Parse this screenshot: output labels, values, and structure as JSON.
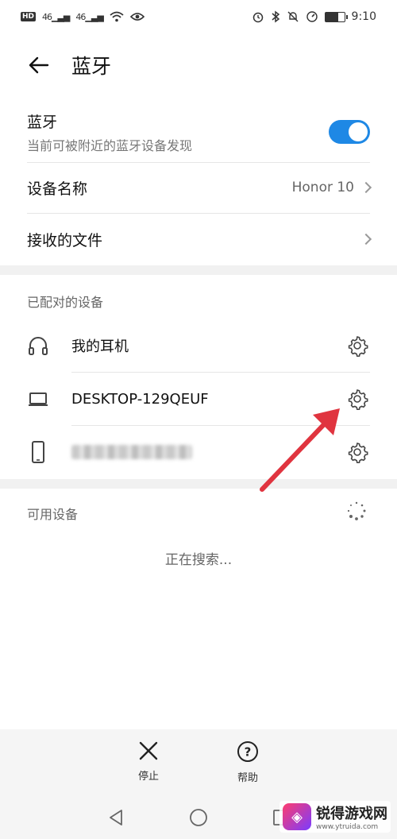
{
  "status_bar": {
    "left_badge": "HD",
    "sig1": "46",
    "sig2": "46",
    "time": "9:10"
  },
  "header": {
    "title": "蓝牙"
  },
  "bluetooth": {
    "label": "蓝牙",
    "sub": "当前可被附近的蓝牙设备发现",
    "on": true
  },
  "device_name": {
    "label": "设备名称",
    "value": "Honor 10"
  },
  "received_files": {
    "label": "接收的文件"
  },
  "paired": {
    "title": "已配对的设备",
    "items": [
      {
        "name": "我的耳机",
        "icon": "headphones-icon"
      },
      {
        "name": "DESKTOP-129QEUF",
        "icon": "laptop-icon"
      },
      {
        "name": "",
        "icon": "phone-icon"
      }
    ]
  },
  "available": {
    "title": "可用设备",
    "searching": "正在搜索..."
  },
  "toolbar": {
    "stop_label": "停止",
    "help_label": "帮助"
  },
  "watermark": {
    "name": "锐得游戏网",
    "url": "www.ytruida.com"
  },
  "colors": {
    "accent": "#1e88e5",
    "arrow": "#e0343f"
  }
}
